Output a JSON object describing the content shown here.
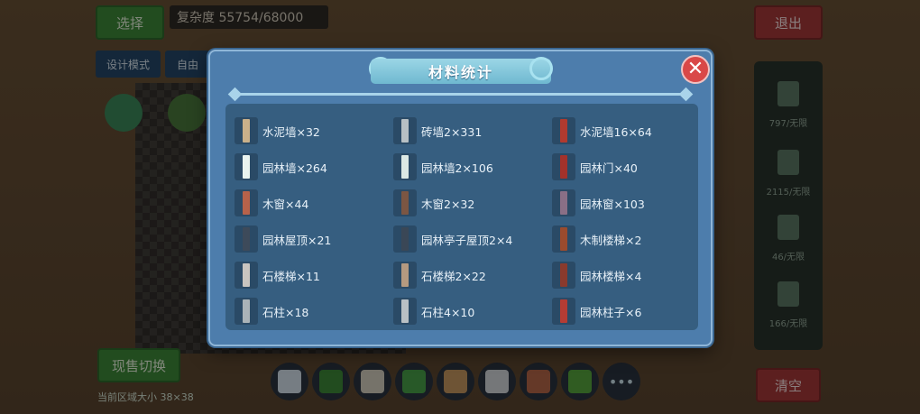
{
  "hud": {
    "select_label": "选择",
    "complexity_label": "复杂度 55754/68000",
    "design_mode_label": "设计模式",
    "free_label": "自由",
    "exit_label": "退出",
    "skin_switch_label": "现售切换",
    "clear_label": "清空",
    "size_text": "当前区域大小 38×38"
  },
  "side_panel": {
    "items": [
      {
        "label": "797/无限",
        "icon": "wall-icon"
      },
      {
        "label": "2115/无限",
        "icon": "floor-icon"
      },
      {
        "label": "46/无限",
        "icon": "window-icon"
      },
      {
        "label": "166/无限",
        "icon": "plant-icon"
      }
    ]
  },
  "modal": {
    "title": "材料统计",
    "close_symbol": "✕",
    "items": [
      {
        "label": "水泥墙×32",
        "icon": "cement-wall-icon",
        "color": "#c9b08a"
      },
      {
        "label": "砖墙2×331",
        "icon": "brick-wall-icon",
        "color": "#b7c0c4"
      },
      {
        "label": "水泥墙16×64",
        "icon": "cement-wall-icon",
        "color": "#b13a2f"
      },
      {
        "label": "园林墙×264",
        "icon": "garden-wall-icon",
        "color": "#e9f3ef"
      },
      {
        "label": "园林墙2×106",
        "icon": "garden-wall-icon",
        "color": "#dbe8e4"
      },
      {
        "label": "园林门×40",
        "icon": "garden-door-icon",
        "color": "#a3322b"
      },
      {
        "label": "木窗×44",
        "icon": "wood-window-icon",
        "color": "#b7624a"
      },
      {
        "label": "木窗2×32",
        "icon": "wood-window-icon",
        "color": "#7b5643"
      },
      {
        "label": "园林窗×103",
        "icon": "garden-window-icon",
        "color": "#8a6f86"
      },
      {
        "label": "园林屋顶×21",
        "icon": "garden-roof-icon",
        "color": "#3d4a5a"
      },
      {
        "label": "园林亭子屋顶2×4",
        "icon": "pavilion-roof-icon",
        "color": "#3a4756"
      },
      {
        "label": "木制楼梯×2",
        "icon": "wood-stairs-icon",
        "color": "#9a4b2e"
      },
      {
        "label": "石楼梯×11",
        "icon": "stone-stairs-icon",
        "color": "#c9c5c0"
      },
      {
        "label": "石楼梯2×22",
        "icon": "stone-stairs-icon",
        "color": "#b59a80"
      },
      {
        "label": "园林楼梯×4",
        "icon": "garden-stairs-icon",
        "color": "#8a3a2d"
      },
      {
        "label": "石柱×18",
        "icon": "stone-pillar-icon",
        "color": "#aab3b8"
      },
      {
        "label": "石柱4×10",
        "icon": "stone-pillar-icon",
        "color": "#b9c0c4"
      },
      {
        "label": "园林柱子×6",
        "icon": "garden-pillar-icon",
        "color": "#b43c34"
      }
    ]
  }
}
